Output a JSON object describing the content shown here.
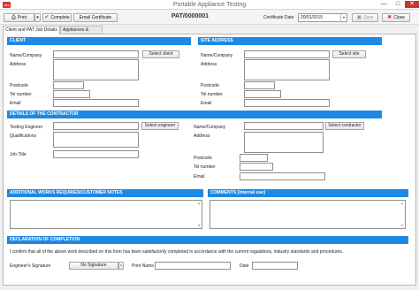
{
  "window": {
    "title": "Portable Appliance Testing",
    "app_icon_text": "PAT",
    "minimize_glyph": "—",
    "maximize_glyph": "□",
    "close_glyph": "✕"
  },
  "toolbar": {
    "print_label": "Print",
    "print_icon": "printer-icon",
    "dropdown_glyph": "▾",
    "complete_label": "Complete",
    "complete_icon": "check-icon",
    "email_label": "Email Certificate",
    "pat_number": "PAT/0000001",
    "certificate_date_label": "Certificate Date",
    "certificate_date_value": "20/01/2015",
    "save_label": "Save",
    "save_icon": "save-icon",
    "close_label": "Close",
    "close_icon": "close-icon"
  },
  "tabs": [
    {
      "label": "Client and PAT Job Details",
      "active": true
    },
    {
      "label": "Appliances & Tests",
      "active": false
    }
  ],
  "client": {
    "header": "CLIENT",
    "name_label": "Name/Company",
    "select_button": "Select client",
    "address_label": "Address",
    "postcode_label": "Postcode",
    "tel_label": "Tel number",
    "email_label": "Email"
  },
  "site": {
    "header": "SITE ADDRESS",
    "name_label": "Name/Company",
    "select_button": "Select site",
    "address_label": "Address",
    "postcode_label": "Postcode",
    "tel_label": "Tel number",
    "email_label": "Email"
  },
  "contractor": {
    "header": "DETAILS OF THE CONTRACTOR",
    "engineer_label": "Testing Engineer",
    "select_engineer_button": "Select engineer",
    "qualifications_label": "Qualifications",
    "job_title_label": "Job Title",
    "name_label": "Name/Company",
    "select_contractor_button": "Select contractor",
    "address_label": "Address",
    "postcode_label": "Postcode",
    "tel_label": "Tel number",
    "email_label": "Email"
  },
  "notes": {
    "additional_header": "ADDITIONAL WORKS REQUIRED/CUSTOMER NOTES",
    "comments_header": "COMMENTS [Internal use]",
    "scroll_up_glyph": "▲",
    "scroll_down_glyph": "▼"
  },
  "declaration": {
    "header": "DECLARATION OF COMPLETION",
    "text": "I confirm that all of the above work described on this form has been satisfactorily completed in accordance with the current regulations, industry standards and procedures.",
    "signature_label": "Engineer's Signature",
    "signature_value": "No Signature",
    "print_name_label": "Print Name",
    "date_label": "Date",
    "caret_glyph": "▾"
  },
  "colors": {
    "section_header": "#1e88e5",
    "close_button": "#c7372f"
  }
}
